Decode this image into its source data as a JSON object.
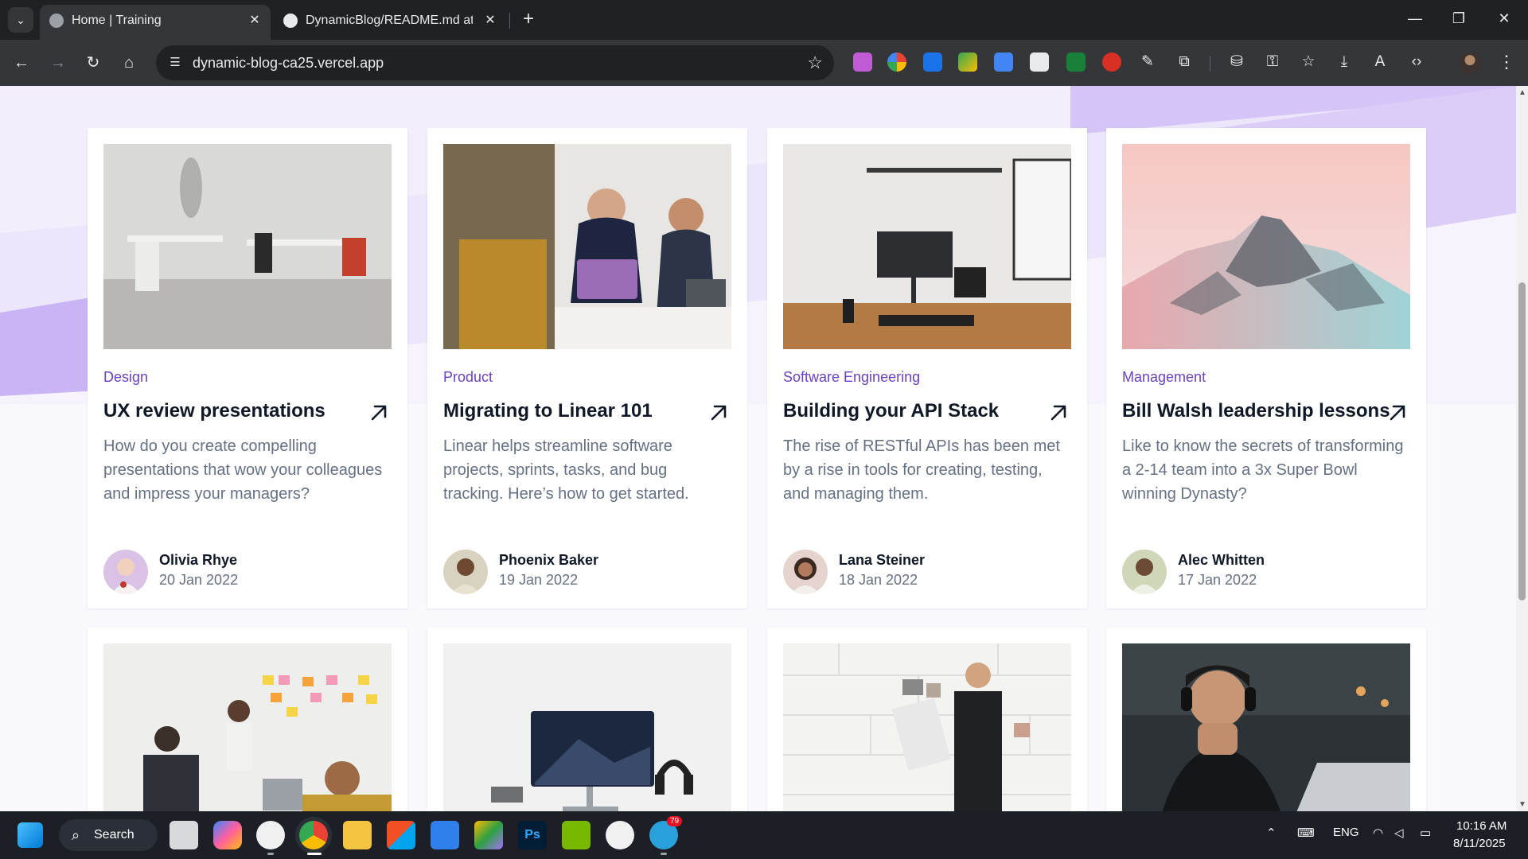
{
  "browser": {
    "tabs": [
      {
        "title": "Home | Training",
        "active": true
      },
      {
        "title": "DynamicBlog/README.md at main",
        "active": false
      }
    ],
    "tab_list_icon": "chevron-down-icon",
    "new_tab_label": "+",
    "close_label": "✕",
    "url": "dynamic-blog-ca25.vercel.app",
    "controls": {
      "minimize": "—",
      "restore": "❐",
      "close": "✕"
    }
  },
  "page": {
    "accent_color": "#6941c6",
    "posts": [
      {
        "category": "Design",
        "title": "UX review presentations",
        "excerpt": "How do you create compelling presentations that wow your colleagues and impress your managers?",
        "author": "Olivia Rhye",
        "date": "20 Jan 2022",
        "image": "office-desks-photo"
      },
      {
        "category": "Product",
        "title": "Migrating to Linear 101",
        "excerpt": "Linear helps streamline software projects, sprints, tasks, and bug tracking. Here’s how to get started.",
        "author": "Phoenix Baker",
        "date": "19 Jan 2022",
        "image": "team-meeting-photo"
      },
      {
        "category": "Software Engineering",
        "title": "Building your API Stack",
        "excerpt": "The rise of RESTful APIs has been met by a rise in tools for creating, testing, and managing them.",
        "author": "Lana Steiner",
        "date": "18 Jan 2022",
        "image": "desk-setup-photo"
      },
      {
        "category": "Management",
        "title": "Bill Walsh leadership lessons",
        "excerpt": "Like to know the secrets of transforming a 2-14 team into a 3x Super Bowl winning Dynasty?",
        "author": "Alec Whitten",
        "date": "17 Jan 2022",
        "image": "mountain-photo"
      },
      {
        "image": "sticky-notes-meeting-photo"
      },
      {
        "image": "monitor-headphones-photo"
      },
      {
        "image": "wall-photos-photo"
      },
      {
        "image": "man-laptop-photo"
      }
    ]
  },
  "taskbar": {
    "search_label": "Search",
    "language": "ENG",
    "time": "10:16 AM",
    "date": "8/11/2025",
    "telegram_badge": "79"
  }
}
